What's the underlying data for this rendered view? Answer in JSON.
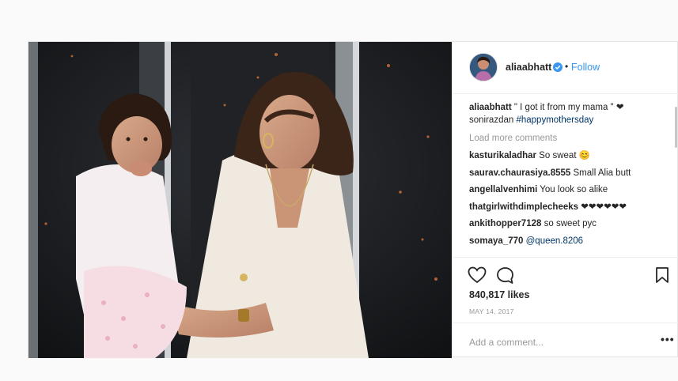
{
  "post": {
    "username": "aliaabhatt",
    "separator": "•",
    "follow_label": "Follow",
    "caption": {
      "user": "aliaabhatt",
      "text": " \" I got it from my mama \" ❤",
      "mention": "sonirazdan",
      "hashtag": "#happymothersday"
    },
    "load_more": "Load more comments",
    "comments": [
      {
        "user": "kasturikaladhar",
        "text": "So sweat 😊"
      },
      {
        "user": "saurav.chaurasiya.8555",
        "text": "Small Alia butt"
      },
      {
        "user": "angellalvenhimi",
        "text": "You look so alike"
      },
      {
        "user": "thatgirlwithdimplecheeks",
        "text": "❤❤❤❤❤❤"
      },
      {
        "user": "ankithopper7128",
        "text": "so sweet рус"
      },
      {
        "user": "somaya_770",
        "text": "@queen.8206"
      }
    ],
    "likes": "840,817 likes",
    "date": "MAY 14, 2017",
    "add_comment_placeholder": "Add a comment...",
    "more_options": "•••"
  },
  "icons": {
    "like": "heart-icon",
    "comment": "comment-icon",
    "save": "bookmark-icon",
    "verified": "verified-badge-icon"
  },
  "colors": {
    "link": "#3897f0",
    "hashtag": "#003569",
    "verified": "#3897f0",
    "muted": "#999999"
  }
}
